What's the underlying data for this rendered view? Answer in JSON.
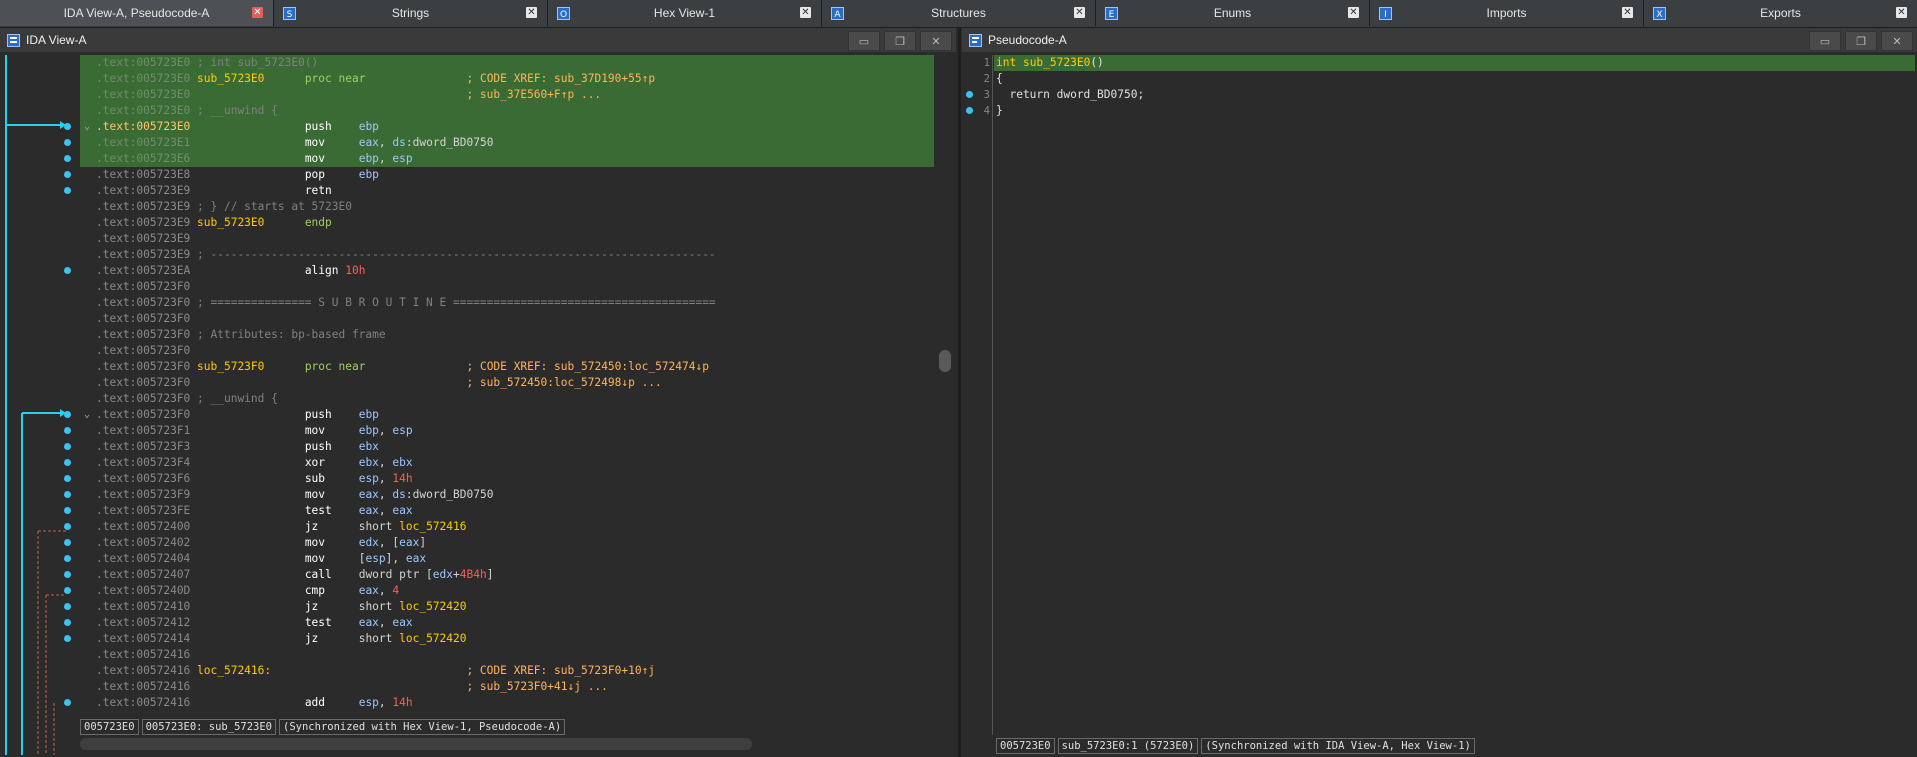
{
  "tabs": [
    {
      "label": "IDA View-A, Pseudocode-A",
      "icon": "none",
      "active": true
    },
    {
      "label": "Strings",
      "icon": "strings-icon"
    },
    {
      "label": "Hex View-1",
      "icon": "hex-icon"
    },
    {
      "label": "Structures",
      "icon": "structures-icon"
    },
    {
      "label": "Enums",
      "icon": "enums-icon"
    },
    {
      "label": "Imports",
      "icon": "imports-icon"
    },
    {
      "label": "Exports",
      "icon": "exports-icon"
    }
  ],
  "left_panel": {
    "title": "IDA View-A",
    "status": [
      "005723E0",
      "005723E0: sub_5723E0",
      "(Synchronized with Hex View-1, Pseudocode-A)"
    ]
  },
  "right_panel": {
    "title": "Pseudocode-A",
    "status": [
      "005723E0",
      "sub_5723E0:1 (5723E0)",
      "(Synchronized with IDA View-A, Hex View-1)"
    ]
  },
  "disasm": [
    {
      "hl": true,
      "addr": ".text:005723E0",
      "rest": [
        [
          "cmt",
          " ; int sub_5723E0()"
        ]
      ]
    },
    {
      "hl": true,
      "addr": ".text:005723E0",
      "rest": [
        [
          "lbl",
          " sub_5723E0      "
        ],
        [
          "kw",
          "proc near"
        ],
        [
          "op2",
          "               "
        ],
        [
          "xref",
          "; CODE XREF: sub_37D190+55↑p"
        ]
      ]
    },
    {
      "hl": true,
      "addr": ".text:005723E0",
      "rest": [
        [
          "op2",
          "                                         "
        ],
        [
          "xref",
          "; sub_37E560+F↑p ..."
        ]
      ]
    },
    {
      "hl": true,
      "addr": ".text:005723E0",
      "rest": [
        [
          "cmt",
          " ; __unwind {"
        ]
      ]
    },
    {
      "hl": true,
      "fold": true,
      "addr": ".text:005723E0",
      "cur": true,
      "rest": [
        [
          "op2",
          "                 "
        ],
        [
          "mn",
          "push    "
        ],
        [
          "op",
          "ebp"
        ]
      ]
    },
    {
      "hl": true,
      "addr": ".text:005723E1",
      "rest": [
        [
          "op2",
          "                 "
        ],
        [
          "mn",
          "mov     "
        ],
        [
          "op",
          "eax"
        ],
        [
          "op2",
          ", "
        ],
        [
          "op",
          "ds"
        ],
        [
          "op2",
          ":dword_BD0750"
        ]
      ]
    },
    {
      "hl": true,
      "addr": ".text:005723E6",
      "rest": [
        [
          "op2",
          "                 "
        ],
        [
          "mn",
          "mov     "
        ],
        [
          "op",
          "ebp"
        ],
        [
          "op2",
          ", "
        ],
        [
          "op",
          "esp"
        ]
      ]
    },
    {
      "addr": ".text:005723E8",
      "rest": [
        [
          "op2",
          "                 "
        ],
        [
          "mn",
          "pop     "
        ],
        [
          "op",
          "ebp"
        ]
      ]
    },
    {
      "addr": ".text:005723E9",
      "rest": [
        [
          "op2",
          "                 "
        ],
        [
          "mn",
          "retn"
        ]
      ]
    },
    {
      "addr": ".text:005723E9",
      "rest": [
        [
          "cmt",
          " ; } // starts at 5723E0"
        ]
      ]
    },
    {
      "addr": ".text:005723E9",
      "rest": [
        [
          "lbl",
          " sub_5723E0      "
        ],
        [
          "kw",
          "endp"
        ]
      ]
    },
    {
      "addr": ".text:005723E9",
      "rest": []
    },
    {
      "addr": ".text:005723E9",
      "rest": [
        [
          "cmt",
          " ; ---------------------------------------------------------------------------"
        ]
      ]
    },
    {
      "addr": ".text:005723EA",
      "rest": [
        [
          "op2",
          "                 "
        ],
        [
          "mn",
          "align "
        ],
        [
          "num",
          "10h"
        ]
      ]
    },
    {
      "addr": ".text:005723F0",
      "rest": []
    },
    {
      "addr": ".text:005723F0",
      "rest": [
        [
          "cmt",
          " ; =============== S U B R O U T I N E ======================================="
        ]
      ]
    },
    {
      "addr": ".text:005723F0",
      "rest": []
    },
    {
      "addr": ".text:005723F0",
      "rest": [
        [
          "cmt",
          " ; Attributes: bp-based frame"
        ]
      ]
    },
    {
      "addr": ".text:005723F0",
      "rest": []
    },
    {
      "addr": ".text:005723F0",
      "rest": [
        [
          "lbl",
          " sub_5723F0      "
        ],
        [
          "kw",
          "proc near"
        ],
        [
          "op2",
          "               "
        ],
        [
          "xref",
          "; CODE XREF: sub_572450:loc_572474↓p"
        ]
      ]
    },
    {
      "addr": ".text:005723F0",
      "rest": [
        [
          "op2",
          "                                         "
        ],
        [
          "xref",
          "; sub_572450:loc_572498↓p ..."
        ]
      ]
    },
    {
      "addr": ".text:005723F0",
      "rest": [
        [
          "cmt",
          " ; __unwind {"
        ]
      ]
    },
    {
      "fold": true,
      "addr": ".text:005723F0",
      "rest": [
        [
          "op2",
          "                 "
        ],
        [
          "mn",
          "push    "
        ],
        [
          "op",
          "ebp"
        ]
      ]
    },
    {
      "addr": ".text:005723F1",
      "rest": [
        [
          "op2",
          "                 "
        ],
        [
          "mn",
          "mov     "
        ],
        [
          "op",
          "ebp"
        ],
        [
          "op2",
          ", "
        ],
        [
          "op",
          "esp"
        ]
      ]
    },
    {
      "addr": ".text:005723F3",
      "rest": [
        [
          "op2",
          "                 "
        ],
        [
          "mn",
          "push    "
        ],
        [
          "op",
          "ebx"
        ]
      ]
    },
    {
      "addr": ".text:005723F4",
      "rest": [
        [
          "op2",
          "                 "
        ],
        [
          "mn",
          "xor     "
        ],
        [
          "op",
          "ebx"
        ],
        [
          "op2",
          ", "
        ],
        [
          "op",
          "ebx"
        ]
      ]
    },
    {
      "addr": ".text:005723F6",
      "rest": [
        [
          "op2",
          "                 "
        ],
        [
          "mn",
          "sub     "
        ],
        [
          "op",
          "esp"
        ],
        [
          "op2",
          ", "
        ],
        [
          "num",
          "14h"
        ]
      ]
    },
    {
      "addr": ".text:005723F9",
      "rest": [
        [
          "op2",
          "                 "
        ],
        [
          "mn",
          "mov     "
        ],
        [
          "op",
          "eax"
        ],
        [
          "op2",
          ", "
        ],
        [
          "op",
          "ds"
        ],
        [
          "op2",
          ":dword_BD0750"
        ]
      ]
    },
    {
      "addr": ".text:005723FE",
      "rest": [
        [
          "op2",
          "                 "
        ],
        [
          "mn",
          "test    "
        ],
        [
          "op",
          "eax"
        ],
        [
          "op2",
          ", "
        ],
        [
          "op",
          "eax"
        ]
      ]
    },
    {
      "addr": ".text:00572400",
      "rest": [
        [
          "op2",
          "                 "
        ],
        [
          "mn",
          "jz      "
        ],
        [
          "op2",
          "short "
        ],
        [
          "lbl",
          "loc_572416"
        ]
      ]
    },
    {
      "addr": ".text:00572402",
      "rest": [
        [
          "op2",
          "                 "
        ],
        [
          "mn",
          "mov     "
        ],
        [
          "op",
          "edx"
        ],
        [
          "op2",
          ", ["
        ],
        [
          "op",
          "eax"
        ],
        [
          "op2",
          "]"
        ]
      ]
    },
    {
      "addr": ".text:00572404",
      "rest": [
        [
          "op2",
          "                 "
        ],
        [
          "mn",
          "mov     "
        ],
        [
          "op2",
          "["
        ],
        [
          "op",
          "esp"
        ],
        [
          "op2",
          "], "
        ],
        [
          "op",
          "eax"
        ]
      ]
    },
    {
      "addr": ".text:00572407",
      "rest": [
        [
          "op2",
          "                 "
        ],
        [
          "mn",
          "call    "
        ],
        [
          "op2",
          "dword ptr ["
        ],
        [
          "op",
          "edx"
        ],
        [
          "op2",
          "+"
        ],
        [
          "num",
          "4B4h"
        ],
        [
          "op2",
          "]"
        ]
      ]
    },
    {
      "addr": ".text:0057240D",
      "rest": [
        [
          "op2",
          "                 "
        ],
        [
          "mn",
          "cmp     "
        ],
        [
          "op",
          "eax"
        ],
        [
          "op2",
          ", "
        ],
        [
          "num",
          "4"
        ]
      ]
    },
    {
      "addr": ".text:00572410",
      "rest": [
        [
          "op2",
          "                 "
        ],
        [
          "mn",
          "jz      "
        ],
        [
          "op2",
          "short "
        ],
        [
          "lbl",
          "loc_572420"
        ]
      ]
    },
    {
      "addr": ".text:00572412",
      "rest": [
        [
          "op2",
          "                 "
        ],
        [
          "mn",
          "test    "
        ],
        [
          "op",
          "eax"
        ],
        [
          "op2",
          ", "
        ],
        [
          "op",
          "eax"
        ]
      ]
    },
    {
      "addr": ".text:00572414",
      "rest": [
        [
          "op2",
          "                 "
        ],
        [
          "mn",
          "jz      "
        ],
        [
          "op2",
          "short "
        ],
        [
          "lbl",
          "loc_572420"
        ]
      ]
    },
    {
      "addr": ".text:00572416",
      "rest": []
    },
    {
      "addr": ".text:00572416",
      "rest": [
        [
          "lbl",
          " loc_572416:"
        ],
        [
          "op2",
          "                             "
        ],
        [
          "xref",
          "; CODE XREF: sub_5723F0+10↑j"
        ]
      ]
    },
    {
      "addr": ".text:00572416",
      "rest": [
        [
          "op2",
          "                                         "
        ],
        [
          "xref",
          "; sub_5723F0+41↓j ..."
        ]
      ]
    },
    {
      "addr": ".text:00572416",
      "rest": [
        [
          "op2",
          "                 "
        ],
        [
          "mn",
          "add     "
        ],
        [
          "op",
          "esp"
        ],
        [
          "op2",
          ", "
        ],
        [
          "num",
          "14h"
        ]
      ]
    }
  ],
  "pseudocode": [
    {
      "n": "1",
      "hl": true,
      "parts": [
        [
          "pkw",
          "int "
        ],
        [
          "pfn",
          "sub_5723E0"
        ],
        [
          "ptext",
          "()"
        ]
      ]
    },
    {
      "n": "2",
      "parts": [
        [
          "ptext",
          "{"
        ]
      ]
    },
    {
      "n": "3",
      "dot": true,
      "parts": [
        [
          "ptext",
          "  return dword_BD0750;"
        ]
      ]
    },
    {
      "n": "4",
      "dot": true,
      "parts": [
        [
          "ptext",
          "}"
        ]
      ]
    }
  ]
}
